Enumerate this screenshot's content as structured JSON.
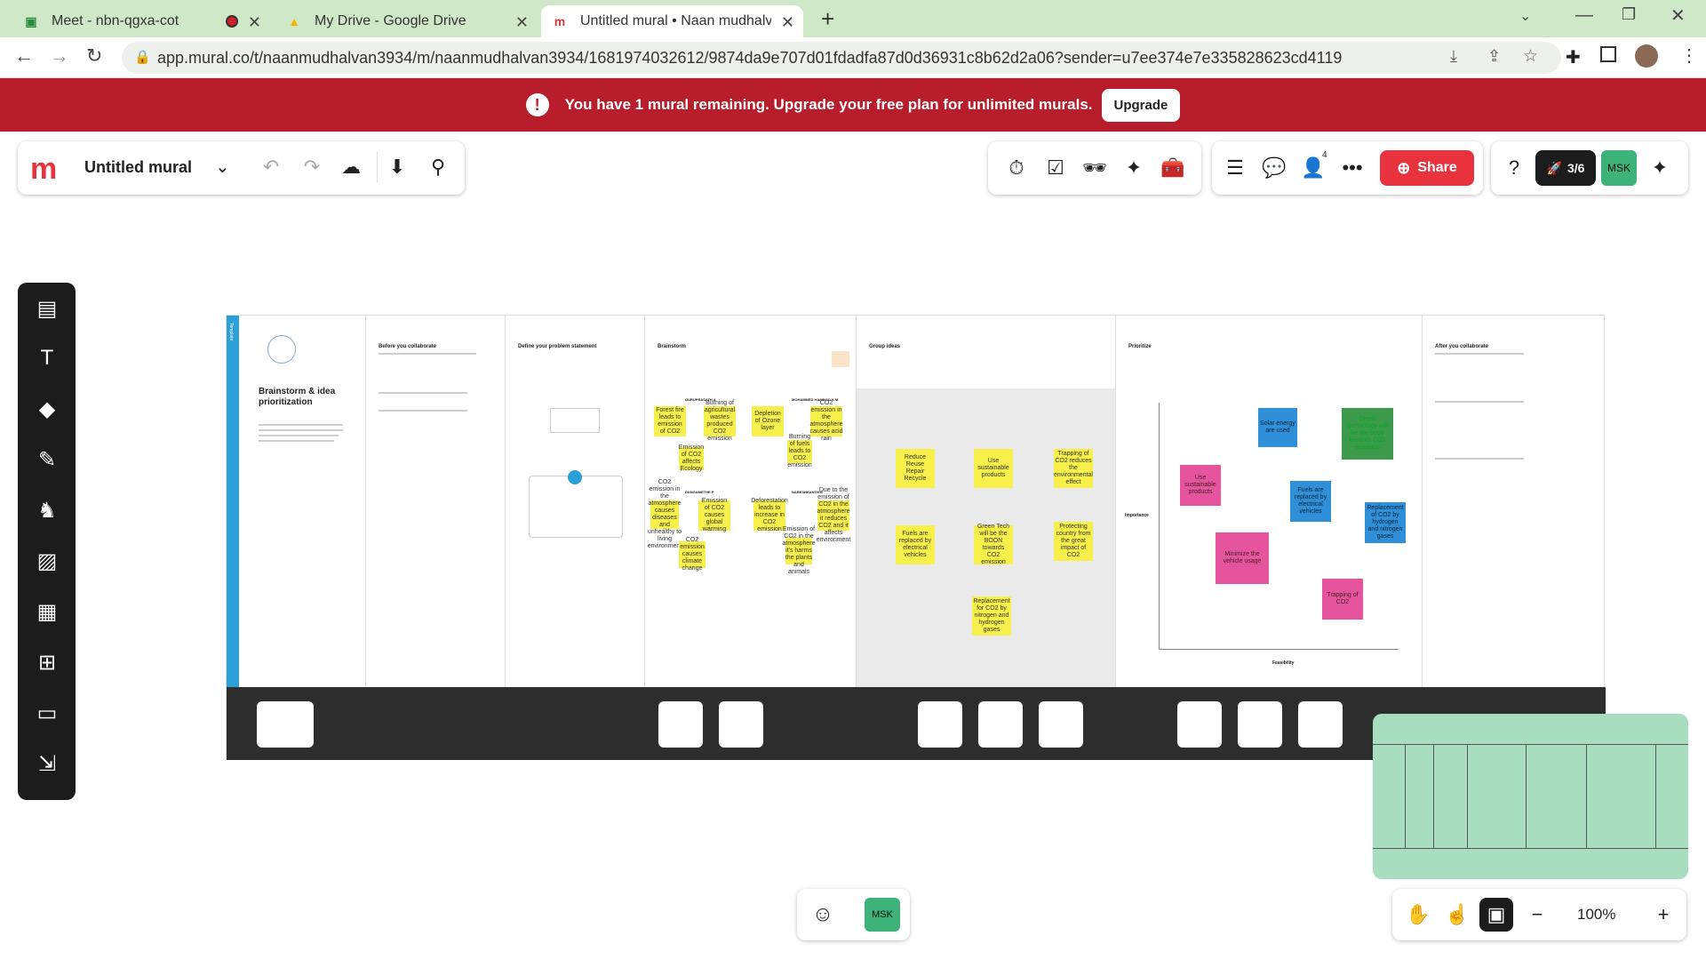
{
  "tabs": [
    {
      "title": "Meet - nbn-qgxa-cot",
      "icon": "meet-icon",
      "recording": true
    },
    {
      "title": "My Drive - Google Drive",
      "icon": "drive-icon"
    },
    {
      "title": "Untitled mural • Naan mudhalvan",
      "icon": "mural-icon",
      "active": true
    }
  ],
  "new_tab": "+",
  "url": "app.mural.co/t/naanmudhalvan3934/m/naanmudhalvan3934/1681974032612/9874da9e707d01fdadfa87d0d36931c8b62d2a06?sender=u7ee374e7e335828623cd4119",
  "banner": {
    "message": "You have 1 mural remaining. Upgrade your free plan for unlimited murals.",
    "button": "Upgrade"
  },
  "mural": {
    "title": "Untitled mural"
  },
  "header": {
    "share": "Share",
    "timer_count": "3/6",
    "user_initials": "MSK",
    "people_count": "4",
    "brand_color": "#e8333f",
    "avatar_color": "#3db37a"
  },
  "zoom": "100%",
  "board": {
    "template": {
      "title": "Brainstorm & idea prioritization",
      "label": "Template"
    },
    "sections": [
      "Before you collaborate",
      "Define your problem statement",
      "Brainstorm",
      "Group ideas",
      "Prioritize",
      "After you collaborate"
    ],
    "brainstorm_names": [
      "GURUPRASATH A",
      "MOHAMMED HAMMAD K M",
      "DANGAMETHE P",
      "NARESHKANTH B"
    ],
    "brainstorm_notes": [
      "Forest fire leads to emission of CO2",
      "Burning of agricultural wastes produced CO2 emission",
      "Depletion of Ozone layer",
      "CO2 emission in the atmosphere causes acid rain",
      "Emission of CO2 affects Ecology",
      "Burning of fuels leads to CO2 emission",
      "CO2 emission in the atmosphere causes diseases and unhealthy to living environment",
      "Emission of CO2 causes global warming",
      "Deforestation leads to increase in CO2 emission",
      "Due to the emission of CO2 in the atmosphere it reduces CO2 and it affects environment",
      "CO2 emission causes climate change",
      "Emission of CO2 in the atmosphere it's harms the plants and animals"
    ],
    "group_notes": [
      "Reduce Reuse Repair Recycle",
      "Use sustainable products",
      "Trapping of CO2 reduces the environmental effect",
      "Fuels are replaced by electrical vehicles",
      "Green Tech will be the BOON towards CO2 emission",
      "Protecting country from the great impact of CO2",
      "Replacement for CO2 by nitrogen and hydrogen gases"
    ],
    "priority_notes": [
      "Solar energy are used",
      "Green technology will be the boon towards CO2 emission",
      "Use sustainable products",
      "Fuels are replaced by electrical vehicles",
      "Replacement of CO2 by hydrogen and nitrogen gases",
      "Minimize the vehicle usage",
      "Trapping of CO2"
    ],
    "axis": {
      "y": "Importance",
      "x": "Feasibility"
    }
  }
}
